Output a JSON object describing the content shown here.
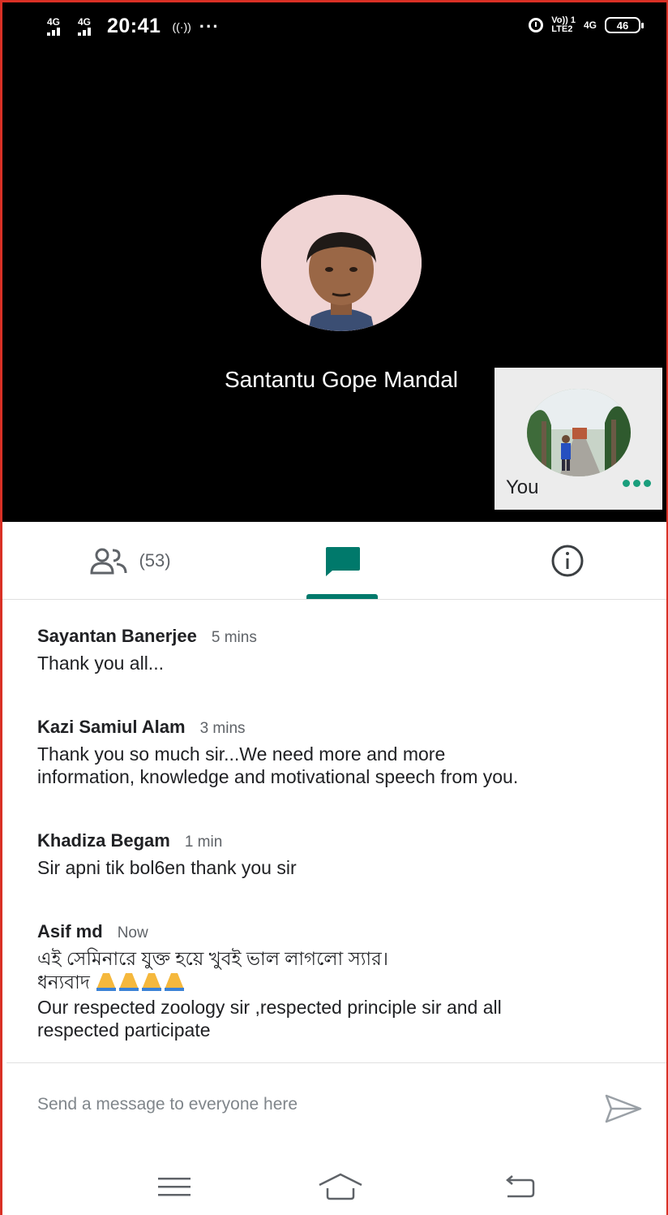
{
  "status_bar": {
    "signal1_label": "4G",
    "signal2_label": "4G",
    "time": "20:41",
    "more": "···",
    "volte_top": "Vo)) 1",
    "volte_bottom": "LTE2",
    "net": "4G",
    "battery": "46"
  },
  "call": {
    "main_participant_name": "Santantu Gope Mandal",
    "self_label": "You"
  },
  "tabs": {
    "people_count": "(53)",
    "active": "chat"
  },
  "messages": [
    {
      "sender": "Sayantan Banerjee",
      "time": "5 mins",
      "text": "Thank you all..."
    },
    {
      "sender": "Kazi Samiul Alam",
      "time": "3 mins",
      "text": "Thank you so much sir...We need more and more\ninformation, knowledge and motivational speech from you."
    },
    {
      "sender": "Khadiza Begam",
      "time": "1 min",
      "text": "Sir apni tik bol6en thank you sir"
    },
    {
      "sender": "Asif md",
      "time": "Now",
      "text_line1": "এই সেমিনারে যুক্ত হয়ে খুবই ভাল লাগলো স্যার।",
      "text_line2": "ধন্যবাদ",
      "text_line3": "Our respected zoology sir ,respected principle sir and all\nrespected participate"
    }
  ],
  "compose": {
    "placeholder": "Send a message to everyone here"
  },
  "colors": {
    "accent": "#00796b",
    "self_dots": "#1a9e7c",
    "frame": "#d93025"
  }
}
